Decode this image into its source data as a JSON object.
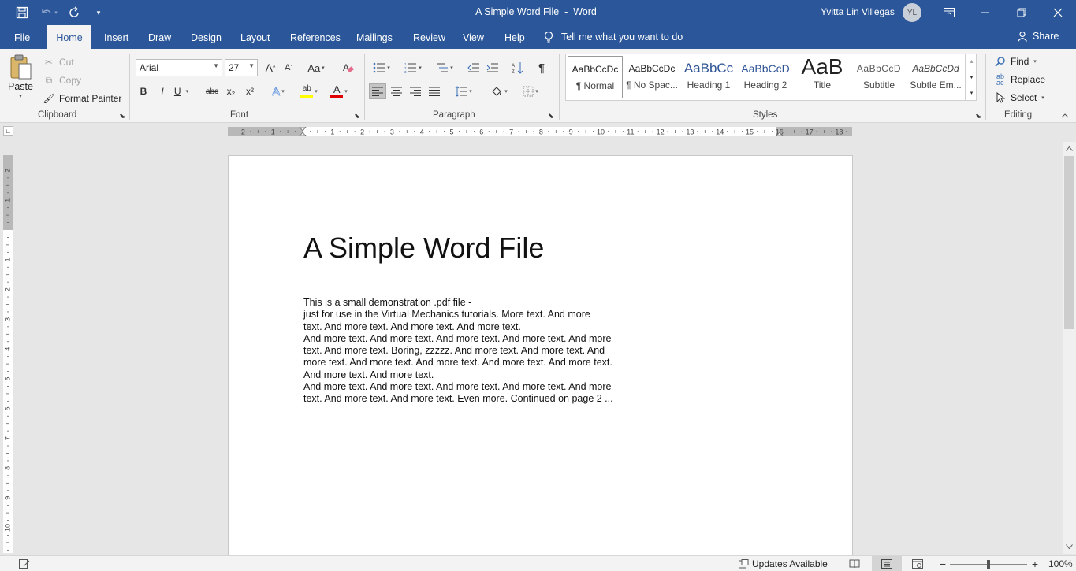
{
  "titlebar": {
    "doc_title": "A Simple Word File  -  Word",
    "user_name": "Yvitta Lin Villegas",
    "avatar_initials": "YL"
  },
  "tabs": [
    {
      "label": "File"
    },
    {
      "label": "Home"
    },
    {
      "label": "Insert"
    },
    {
      "label": "Draw"
    },
    {
      "label": "Design"
    },
    {
      "label": "Layout"
    },
    {
      "label": "References"
    },
    {
      "label": "Mailings"
    },
    {
      "label": "Review"
    },
    {
      "label": "View"
    },
    {
      "label": "Help"
    }
  ],
  "tell_me": "Tell me what you want to do",
  "share": "Share",
  "clipboard": {
    "paste": "Paste",
    "cut": "Cut",
    "copy": "Copy",
    "format_painter": "Format Painter",
    "label": "Clipboard"
  },
  "font": {
    "name": "Arial",
    "size": "27",
    "label": "Font",
    "change_case": "Aa",
    "bold": "B",
    "italic": "I",
    "underline": "U",
    "strike": "abc",
    "subscript": "x₂",
    "superscript": "x²",
    "grow": "A",
    "shrink": "A",
    "text_effects": "A",
    "highlight": "ab",
    "font_color": "A"
  },
  "paragraph": {
    "label": "Paragraph"
  },
  "styles": {
    "label": "Styles",
    "items": [
      {
        "preview": "AaBbCcDc",
        "name": "¶ Normal"
      },
      {
        "preview": "AaBbCcDc",
        "name": "¶ No Spac..."
      },
      {
        "preview": "AaBbCc",
        "name": "Heading 1"
      },
      {
        "preview": "AaBbCcD",
        "name": "Heading 2"
      },
      {
        "preview": "AaB",
        "name": "Title"
      },
      {
        "preview": "AaBbCcD",
        "name": "Subtitle"
      },
      {
        "preview": "AaBbCcDd",
        "name": "Subtle Em..."
      }
    ]
  },
  "editing": {
    "find": "Find",
    "replace": "Replace",
    "select": "Select",
    "label": "Editing"
  },
  "ruler": {
    "h_numbers": [
      "2",
      "1",
      "1",
      "2",
      "3",
      "4",
      "5",
      "6",
      "7",
      "8",
      "9",
      "10",
      "11",
      "12",
      "13",
      "14",
      "15",
      "16",
      "17",
      "18"
    ],
    "v_numbers": [
      "2",
      "1",
      "1",
      "2",
      "3",
      "4",
      "5",
      "6",
      "7",
      "8",
      "9",
      "10"
    ]
  },
  "document": {
    "heading": "A Simple Word File",
    "lines": [
      "This is a small demonstration .pdf file -",
      "just for use in the Virtual Mechanics tutorials. More text. And more",
      "text. And more text. And more text. And more text.",
      "And more text. And more text. And more text. And more text. And more",
      "text. And more text. Boring, zzzzz. And more text. And more text. And",
      "more text. And more text. And more text. And more text. And more text.",
      "And more text. And more text.",
      "And more text. And more text. And more text. And more text. And more",
      "text. And more text. And more text. Even more. Continued on page 2 ..."
    ]
  },
  "status": {
    "updates": "Updates Available",
    "zoom": "100%"
  },
  "colors": {
    "accent": "#2b579a",
    "ribbon_bg": "#f3f3f3",
    "highlight_yellow": "#ffff00",
    "font_red": "#e00000"
  }
}
